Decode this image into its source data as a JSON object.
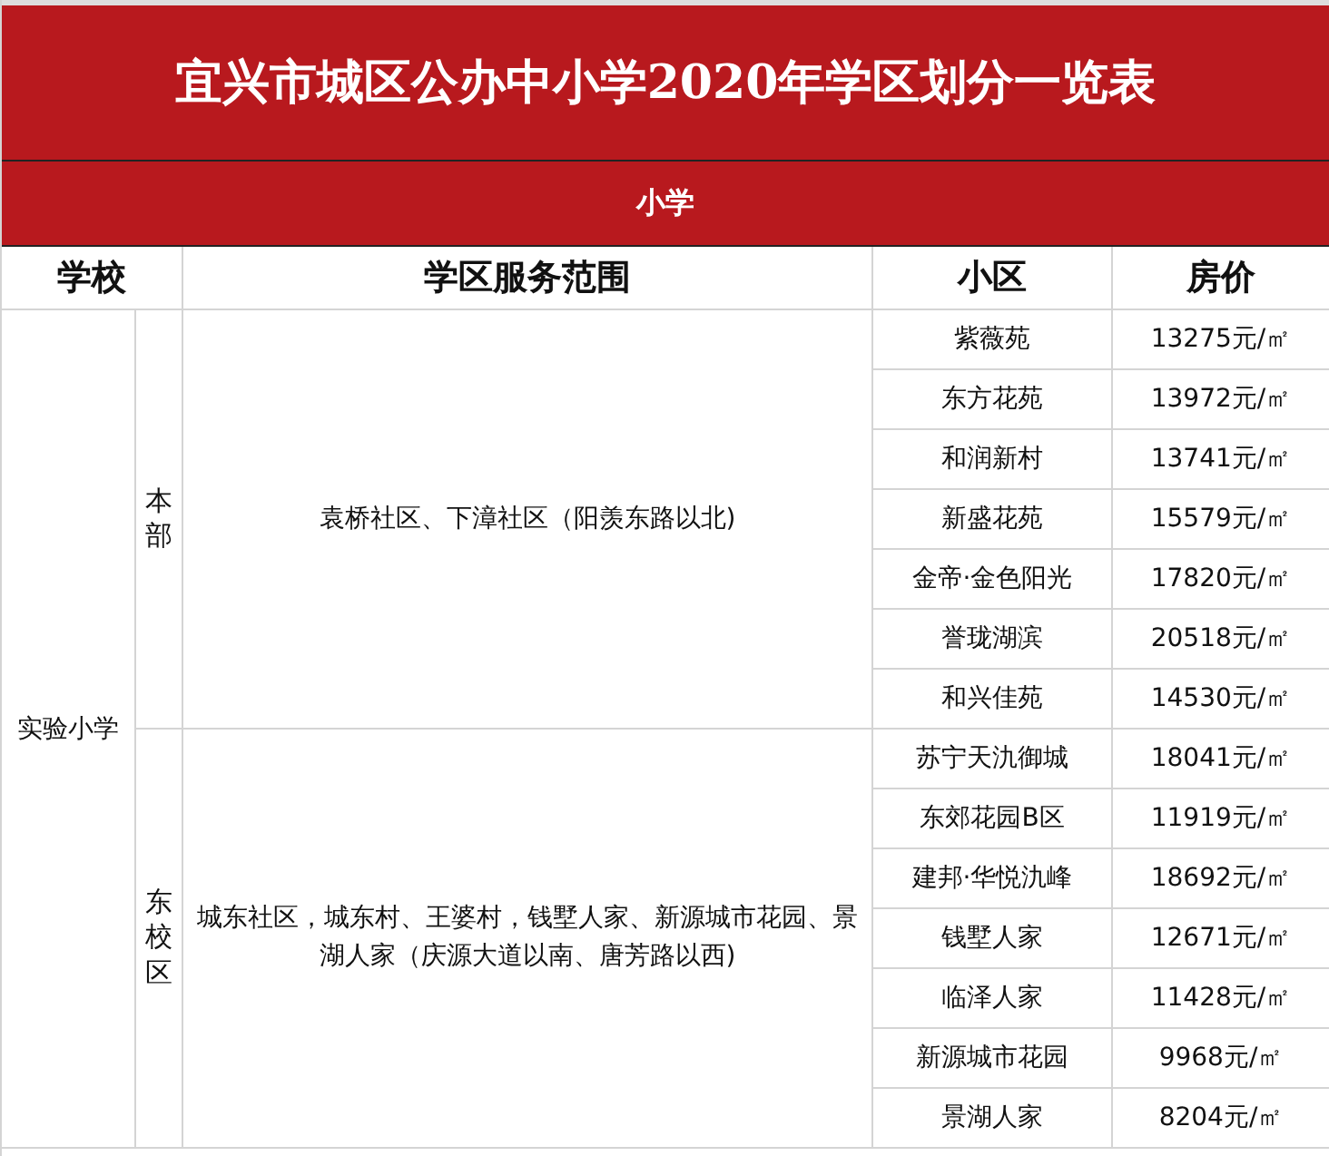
{
  "title": "宜兴市城区公办中小学2020年学区划分一览表",
  "section": "小学",
  "columns": [
    {
      "label": "学校"
    },
    {
      "label": "学区服务范围"
    },
    {
      "label": "小区"
    },
    {
      "label": "房价"
    }
  ],
  "schools": [
    {
      "name": "实验小学",
      "campuses": [
        {
          "name": "本部",
          "area": "袁桥社区、下漳社区（阳羡东路以北)",
          "communities": [
            {
              "name": "紫薇苑",
              "price": "13275元/㎡"
            },
            {
              "name": "东方花苑",
              "price": "13972元/㎡"
            },
            {
              "name": "和润新村",
              "price": "13741元/㎡"
            },
            {
              "name": "新盛花苑",
              "price": "15579元/㎡"
            },
            {
              "name": "金帝·金色阳光",
              "price": "17820元/㎡"
            },
            {
              "name": "誉珑湖滨",
              "price": "20518元/㎡"
            },
            {
              "name": "和兴佳苑",
              "price": "14530元/㎡"
            }
          ]
        },
        {
          "name": "东校区",
          "area": "城东社区，城东村、王婆村，钱墅人家、新源城市花园、景湖人家（庆源大道以南、唐芳路以西)",
          "communities": [
            {
              "name": "苏宁天氿御城",
              "price": "18041元/㎡"
            },
            {
              "name": "东郊花园B区",
              "price": "11919元/㎡"
            },
            {
              "name": "建邦·华悦氿峰",
              "price": "18692元/㎡"
            },
            {
              "name": "钱墅人家",
              "price": "12671元/㎡"
            },
            {
              "name": "临泽人家",
              "price": "11428元/㎡"
            },
            {
              "name": "新源城市花园",
              "price": "9968元/㎡"
            },
            {
              "name": "景湖人家",
              "price": "8204元/㎡"
            }
          ]
        }
      ]
    }
  ]
}
